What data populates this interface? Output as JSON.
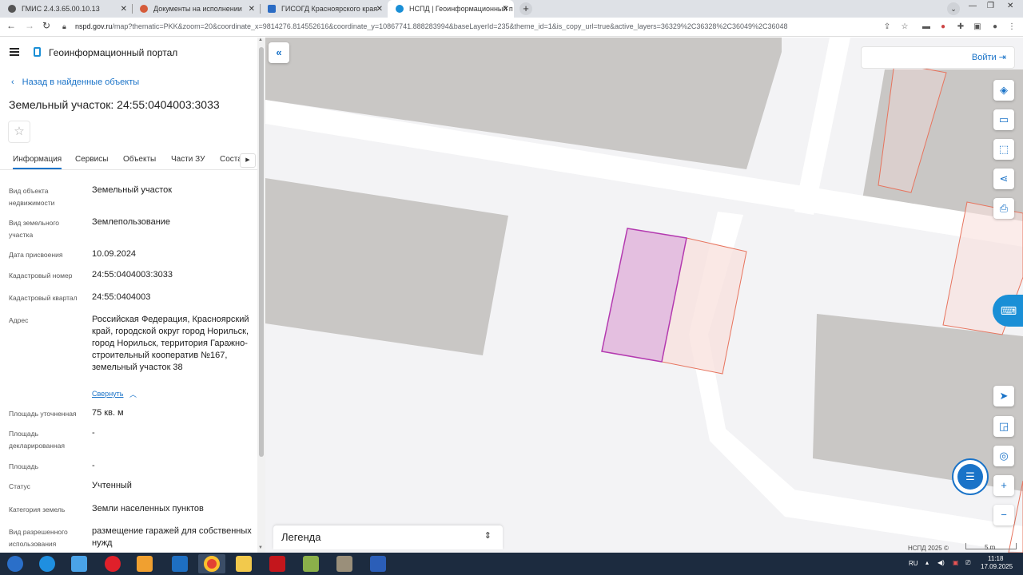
{
  "browser": {
    "tabs": [
      {
        "title": "ГМИС 2.4.3.65.00.10.13",
        "active": false
      },
      {
        "title": "Документы на исполнении",
        "active": false
      },
      {
        "title": "ГИСОГД Красноярского края",
        "active": false
      },
      {
        "title": "НСПД | Геоинформационный п",
        "active": true
      }
    ],
    "new_tab": "+",
    "url_host": "nspd.gov.ru",
    "url_path": "/map?thematic=PKK&zoom=20&coordinate_x=9814276.814552616&coordinate_y=10867741.888283994&baseLayerId=235&theme_id=1&is_copy_url=true&active_layers=36329%2C36328%2C36049%2C36048"
  },
  "sidebar": {
    "portal_title": "Геоинформационный портал",
    "back_link": "Назад в найденные объекты",
    "parcel_title": "Земельный участок: 24:55:0404003:3033",
    "tabs": [
      "Информация",
      "Сервисы",
      "Объекты",
      "Части ЗУ",
      "Соста"
    ],
    "fields": [
      {
        "label": "Вид объекта недвижимости",
        "value": "Земельный участок"
      },
      {
        "label": "Вид земельного участка",
        "value": "Землепользование"
      },
      {
        "label": "Дата присвоения",
        "value": "10.09.2024"
      },
      {
        "label": "Кадастровый номер",
        "value": "24:55:0404003:3033"
      },
      {
        "label": "Кадастровый квартал",
        "value": "24:55:0404003"
      },
      {
        "label": "Адрес",
        "value": "Российская Федерация, Красноярский край, городской округ город Норильск, город Норильск, территория Гаражно-строительный кооператив №167, земельный участок 38"
      },
      {
        "label": "Площадь уточненная",
        "value": "75 кв. м"
      },
      {
        "label": "Площадь декларированная",
        "value": "-"
      },
      {
        "label": "Площадь",
        "value": "-"
      },
      {
        "label": "Статус",
        "value": "Учтенный"
      },
      {
        "label": "Категория земель",
        "value": "Земли населенных пунктов"
      },
      {
        "label": "Вид разрешенного использования",
        "value": "размещение гаражей для собственных нужд"
      }
    ],
    "collapse_link": "Свернуть"
  },
  "map": {
    "login": "Войти",
    "legend": "Легенда",
    "copyright": "НСПД 2025 ©",
    "scale": "5 m",
    "colors": {
      "selected_fill": "#e4bfe0",
      "selected_stroke": "#b43ab0",
      "parcel_fill": "#f8e0dc",
      "parcel_stroke": "#e7745e",
      "building": "#c9c7c5",
      "road": "#ffffff",
      "accent": "#1a73c8"
    }
  },
  "taskbar": {
    "language": "RU",
    "time": "11:18",
    "date": "17.09.2025"
  }
}
